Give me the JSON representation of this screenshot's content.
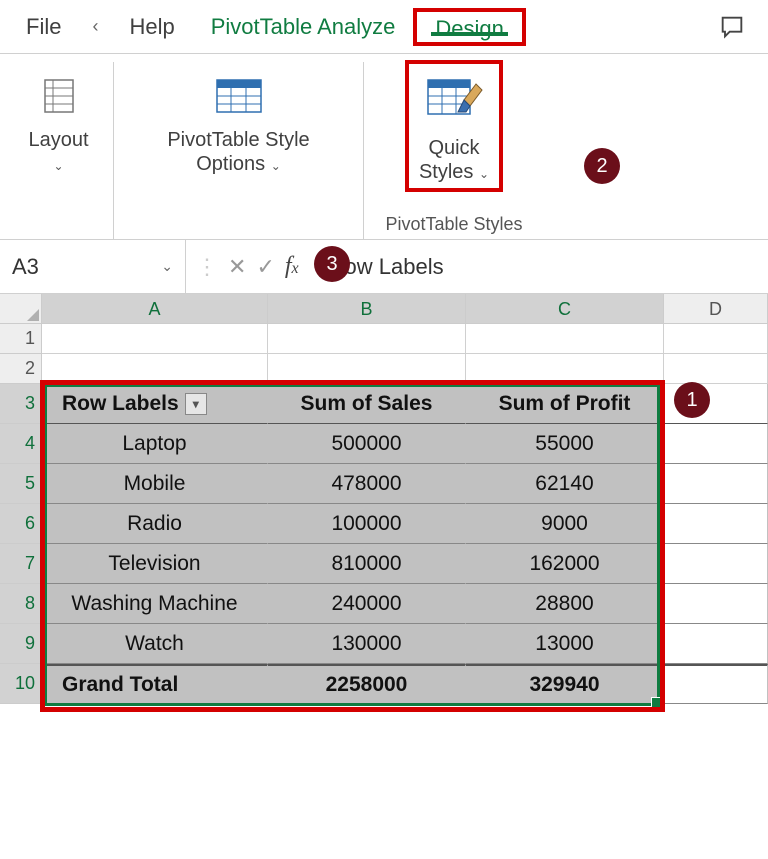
{
  "tabs": {
    "file": "File",
    "help": "Help",
    "analyze": "PivotTable Analyze",
    "design": "Design"
  },
  "ribbon": {
    "layout": "Layout",
    "ptso_line1": "PivotTable Style",
    "ptso_line2": "Options",
    "quick_line1": "Quick",
    "quick_line2": "Styles",
    "group_title": "PivotTable Styles"
  },
  "badges": {
    "one": "1",
    "two": "2",
    "three": "3"
  },
  "formula": {
    "namebox": "A3",
    "content": "Row Labels"
  },
  "cols": {
    "A": "A",
    "B": "B",
    "C": "C",
    "D": "D"
  },
  "rows": {
    "r1": "1",
    "r2": "2",
    "r3": "3",
    "r4": "4",
    "r5": "5",
    "r6": "6",
    "r7": "7",
    "r8": "8",
    "r9": "9",
    "r10": "10"
  },
  "pivot": {
    "header": {
      "a": "Row Labels",
      "b": "Sum of Sales",
      "c": "Sum of Profit"
    },
    "items": [
      {
        "a": "Laptop",
        "b": "500000",
        "c": "55000"
      },
      {
        "a": "Mobile",
        "b": "478000",
        "c": "62140"
      },
      {
        "a": "Radio",
        "b": "100000",
        "c": "9000"
      },
      {
        "a": "Television",
        "b": "810000",
        "c": "162000"
      },
      {
        "a": "Washing Machine",
        "b": "240000",
        "c": "28800"
      },
      {
        "a": "Watch",
        "b": "130000",
        "c": "13000"
      }
    ],
    "total": {
      "a": "Grand Total",
      "b": "2258000",
      "c": "329940"
    }
  }
}
